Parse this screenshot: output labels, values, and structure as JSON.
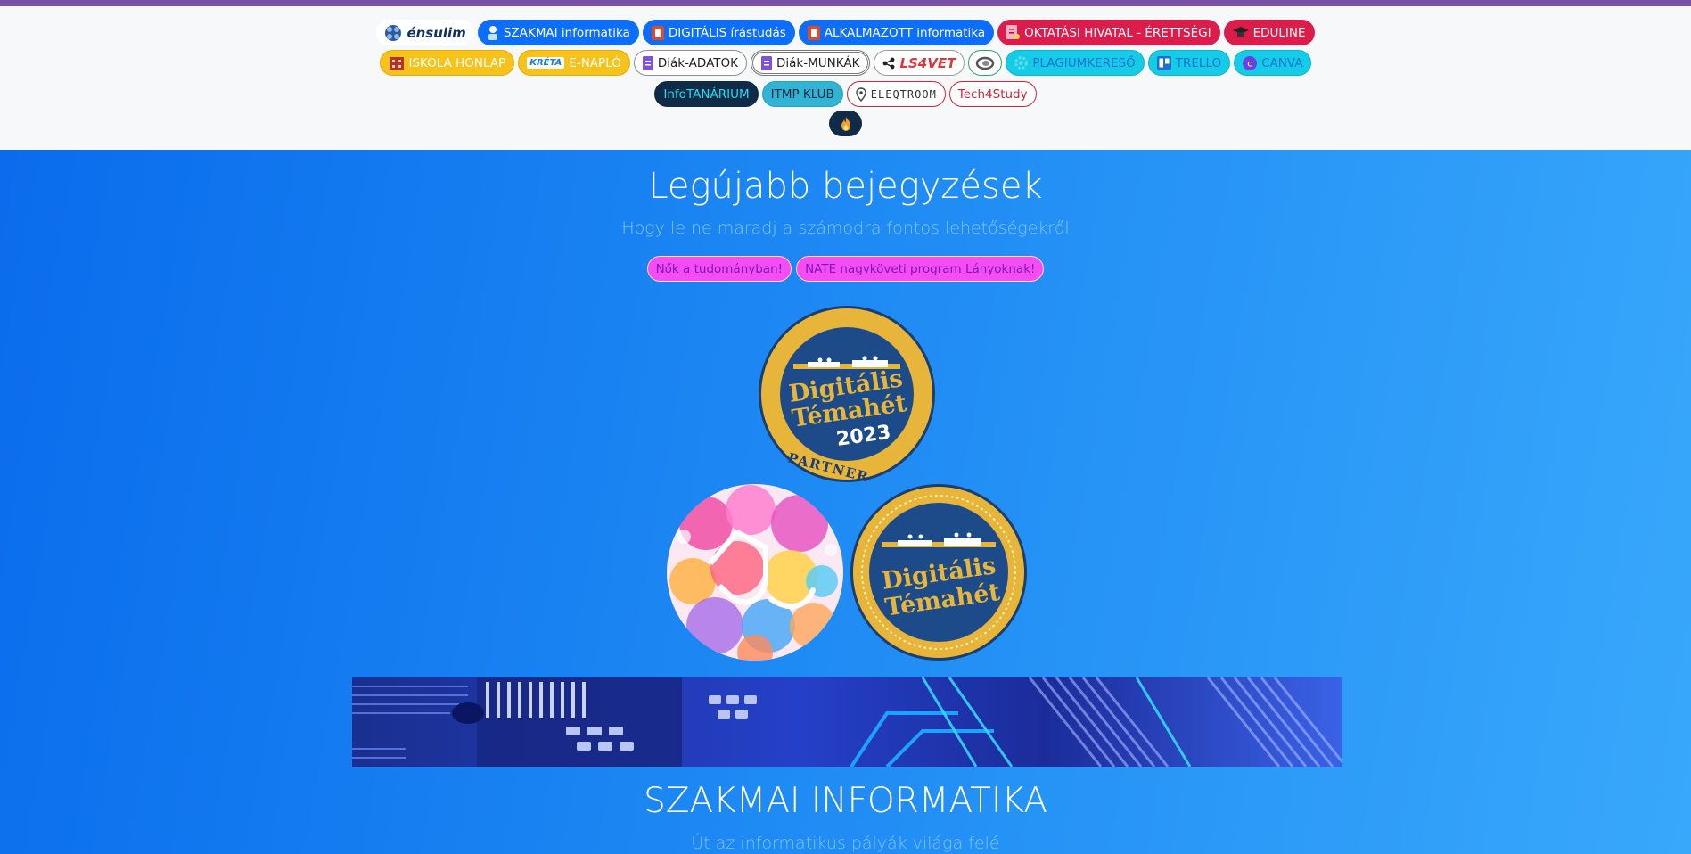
{
  "nav": {
    "row1": [
      {
        "label": "énsulim",
        "icon": "ensulim-logo",
        "style": "logo"
      },
      {
        "label": "SZAKMAI informatika",
        "icon": "school-icon",
        "style": "blue"
      },
      {
        "label": "DIGITÁLIS írástudás",
        "icon": "office-icon",
        "style": "blue"
      },
      {
        "label": "ALKALMAZOTT informatika",
        "icon": "office-icon",
        "style": "blue"
      },
      {
        "label": "OKTATÁSI HIVATAL - ÉRETTSÉGI",
        "icon": "document-icon",
        "style": "red"
      },
      {
        "label": "EDULINE",
        "icon": "graduation-cap-icon",
        "style": "red"
      }
    ],
    "row2": [
      {
        "label": "ISKOLA HONLAP",
        "icon": "building-icon",
        "style": "yellow"
      },
      {
        "label": "E-NAPLÓ",
        "icon": "kreta-logo",
        "badge_text": "KRÉTA",
        "style": "yellow"
      },
      {
        "label": "Diák-ADATOK",
        "icon": "doc-icon",
        "style": "light"
      },
      {
        "label": "Diák-MUNKÁK",
        "icon": "doc-icon",
        "style": "lightsel"
      },
      {
        "label": "LS4VET",
        "icon": "share-icon",
        "style": "ls4vet"
      },
      {
        "label": "",
        "icon": "swirl-icon",
        "style": "outgreen"
      },
      {
        "label": "PLAGIUMKERESŐ",
        "icon": "gear-icon",
        "style": "cyan"
      },
      {
        "label": "TRELLO",
        "icon": "trello-icon",
        "style": "cyan"
      },
      {
        "label": "CANVA",
        "icon": "canva-icon",
        "style": "cyan"
      }
    ],
    "row3": [
      {
        "label": "InfoTANÁRIUM",
        "style": "dark"
      },
      {
        "label": "ITMP KLUB",
        "style": "info"
      },
      {
        "label": "ELEQTROOM",
        "icon": "location-pin-icon",
        "style": "outred"
      },
      {
        "label": "Tech4Study",
        "style": "outred"
      }
    ],
    "row4": [
      {
        "label": "",
        "icon": "fire-icon",
        "style": "dark"
      }
    ]
  },
  "section1": {
    "title": "Legújabb bejegyzések",
    "subtitle": "Hogy le ne maradj a számodra fontos lehetőségekről",
    "tags": [
      "Nők a tudományban!",
      "NATE nagyköveti program Lányoknak!"
    ]
  },
  "badges": {
    "partner": {
      "line1": "Digitális",
      "line2": "Témahét",
      "year": "2023",
      "bottom": "PARTNER"
    },
    "plain": {
      "line1": "Digitális",
      "line2": "Témahét"
    }
  },
  "section2": {
    "title": "SZAKMAI INFORMATIKA",
    "subtitle": "Út az informatikus pályák világa felé"
  },
  "colors": {
    "top_strip": "#7a4fa8",
    "nav_bg": "#f7f8fa",
    "hero_blue": "#0a6cec",
    "badge_gold": "#e8b53b",
    "badge_navy": "#1d4b8a",
    "tag_pink": "#f64cf4"
  }
}
